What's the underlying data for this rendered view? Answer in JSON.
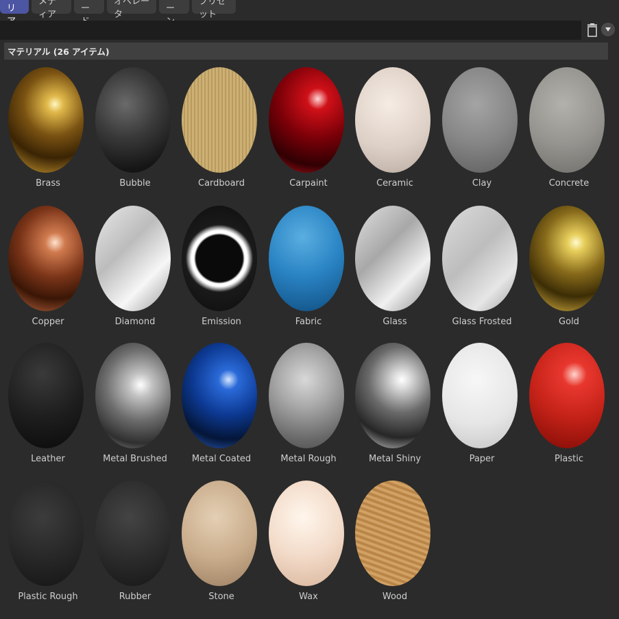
{
  "tabs": [
    {
      "label": "マテリアル",
      "active": true
    },
    {
      "label": "メディア",
      "active": false
    },
    {
      "label": "ノード",
      "active": false
    },
    {
      "label": "オペレータ",
      "active": false
    },
    {
      "label": "シーン",
      "active": false
    },
    {
      "label": "プリセット",
      "active": false
    }
  ],
  "search": {
    "value": "",
    "placeholder": ""
  },
  "header": {
    "title": "マテリアル (26 アイテム)"
  },
  "materials": [
    {
      "name": "Brass",
      "style": "radial-gradient(circle at 62% 35%, #fff7c0 0%, #e0b84a 10%, #7a5212 38%, #3a2404 65%, #b88a2c 92%)"
    },
    {
      "name": "Bubble",
      "style": "radial-gradient(circle at 40% 35%, #6a6a6a 0%, #3a3a3a 40%, #151515 80%), repeating-radial-gradient(circle at 30% 30%, #888 0 3px, transparent 3px 14px)"
    },
    {
      "name": "Cardboard",
      "style": "repeating-linear-gradient(90deg, #cdb074 0 3px, #b89a5e 3px 5px), radial-gradient(circle at 50% 40%, #d9bf87 0%, #9c7e46 100%)"
    },
    {
      "name": "Carpaint",
      "style": "radial-gradient(circle at 65% 30%, #ffd5d5 0%, #d01018 12%, #7a0008 45%, #300003 75%, #b0101a 95%)"
    },
    {
      "name": "Ceramic",
      "style": "radial-gradient(circle at 45% 35%, #f6ece4 0%, #ddd0c6 55%, #b8aaa0 100%)"
    },
    {
      "name": "Clay",
      "style": "radial-gradient(circle at 45% 35%, #a4a4a4 0%, #858585 50%, #5d5d5d 100%)"
    },
    {
      "name": "Concrete",
      "style": "radial-gradient(circle at 45% 35%, #b3b1ab 0%, #96948f 50%, #6f6d69 100%)"
    },
    {
      "name": "Copper",
      "style": "radial-gradient(circle at 62% 35%, #ffe3cf 0%, #d07a4e 12%, #7a3418 42%, #3a1606 68%, #b0603a 94%)"
    },
    {
      "name": "Diamond",
      "style": "linear-gradient(135deg, #e8e8e8 0%, #bcbcbc 40%, #f6f6f6 70%, #9a9a9a 100%)"
    },
    {
      "name": "Emission",
      "style": "radial-gradient(circle at 50% 50%, #0a0a0a 0%, #0a0a0a 36%, #ffffff 39%, #ffffff 43%, #bdbdbd 46%, #1a1a1a 52%, #0d0d0d 100%)"
    },
    {
      "name": "Fabric",
      "style": "radial-gradient(circle at 45% 30%, #5aaee0 0%, #2a84c4 45%, #14578c 90%)"
    },
    {
      "name": "Glass",
      "style": "linear-gradient(135deg, #e0e0e0 0%, #a8a8a8 40%, #f0f0f0 70%, #8e8e8e 100%)"
    },
    {
      "name": "Glass Frosted",
      "style": "linear-gradient(135deg, #dcdcdc 0%, #bdbdbd 45%, #e6e6e6 75%, #9e9e9e 100%)"
    },
    {
      "name": "Gold",
      "style": "radial-gradient(circle at 62% 35%, #fffbd0 0%, #e8cf5c 10%, #86691a 38%, #3c2d06 65%, #c7a33a 92%)"
    },
    {
      "name": "Leather",
      "style": "radial-gradient(circle at 45% 30%, #3a3a3a 0%, #1e1e1e 50%, #0a0a0a 100%)"
    },
    {
      "name": "Metal Brushed",
      "style": "radial-gradient(circle at 60% 40%, #ffffff 0%, #c2c2c2 15%, #6e6e6e 45%, #2f2f2f 75%, #8c8c8c 95%)"
    },
    {
      "name": "Metal Coated",
      "style": "radial-gradient(circle at 62% 35%, #d6e8ff 0%, #2a6ad8 12%, #0d3a94 42%, #041638 72%, #2c5cb8 95%)"
    },
    {
      "name": "Metal Rough",
      "style": "radial-gradient(circle at 48% 35%, #d8d8d8 0%, #a8a8a8 35%, #6a6a6a 75%, #4a4a4a 100%)"
    },
    {
      "name": "Metal Shiny",
      "style": "radial-gradient(circle at 62% 35%, #ffffff 0%, #dcdcdc 10%, #6a6a6a 40%, #262626 70%, #c8c8c8 94%)"
    },
    {
      "name": "Paper",
      "style": "radial-gradient(circle at 45% 35%, #f7f7f7 0%, #e6e6e6 55%, #c4c4c4 100%)"
    },
    {
      "name": "Plastic",
      "style": "radial-gradient(circle at 60% 30%, #ffd4cc 0%, #e8372e 14%, #c42218 50%, #8a0f08 90%)"
    },
    {
      "name": "Plastic Rough",
      "style": "radial-gradient(circle at 45% 35%, #3c3c3c 0%, #262626 55%, #141414 100%)"
    },
    {
      "name": "Rubber",
      "style": "radial-gradient(circle at 45% 35%, #444444 0%, #2a2a2a 55%, #161616 100%)"
    },
    {
      "name": "Stone",
      "style": "radial-gradient(circle at 45% 35%, #e4cfb4 0%, #c9ad8c 50%, #9a7e60 100%)"
    },
    {
      "name": "Wax",
      "style": "radial-gradient(circle at 45% 35%, #fff6ec 0%, #f2dac8 50%, #d8b49a 100%)"
    },
    {
      "name": "Wood",
      "style": "repeating-linear-gradient(20deg, #d2a165 0 4px, #b98648 4px 8px), radial-gradient(circle at 45% 35%, #dcae72 0%, #9c6a32 100%)"
    }
  ]
}
